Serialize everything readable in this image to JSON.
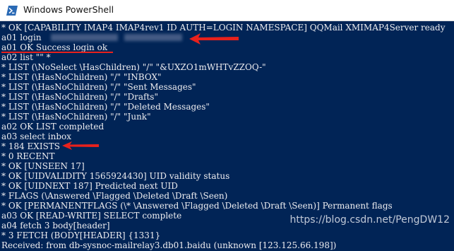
{
  "window": {
    "title": "Windows PowerShell",
    "background": "#012456",
    "foreground": "#eeedf0"
  },
  "console": {
    "lines": [
      "* OK [CAPABILITY IMAP4 IMAP4rev1 ID AUTH=LOGIN NAMESPACE] QQMail XMIMAP4Server ready",
      "a01 login",
      "a01 OK Success login ok",
      "a02 list \"\" *",
      "* LIST (\\NoSelect \\HasChildren) \"/\" \"&UXZO1mWHTvZZOQ-\"",
      "* LIST (\\HasNoChildren) \"/\" \"INBOX\"",
      "* LIST (\\HasNoChildren) \"/\" \"Sent Messages\"",
      "* LIST (\\HasNoChildren) \"/\" \"Drafts\"",
      "* LIST (\\HasNoChildren) \"/\" \"Deleted Messages\"",
      "* LIST (\\HasNoChildren) \"/\" \"Junk\"",
      "a02 OK LIST completed",
      "a03 select inbox",
      "* 184 EXISTS",
      "* 0 RECENT",
      "* OK [UNSEEN 17]",
      "* OK [UIDVALIDITY 1565924430] UID validity status",
      "* OK [UIDNEXT 187] Predicted next UID",
      "* FLAGS (\\Answered \\Flagged \\Deleted \\Draft \\Seen)",
      "* OK [PERMANENTFLAGS (\\* \\Answered \\Flagged \\Deleted \\Draft \\Seen)] Permanent flags",
      "a03 OK [READ-WRITE] SELECT complete",
      "a04 fetch 3 body[header]",
      "* 3 FETCH (BODY[HEADER] {1331}",
      "Received: from db-sysnoc-mailrelay3.db01.baidu (unknown [123.125.66.198])"
    ]
  },
  "annotations": {
    "arrow_color": "#e8211c",
    "arrow_targets": [
      "a01 login",
      "a01 OK Success login ok",
      "* 184 EXISTS"
    ]
  },
  "watermark": "https://blog.csdn.net/PengDW12"
}
